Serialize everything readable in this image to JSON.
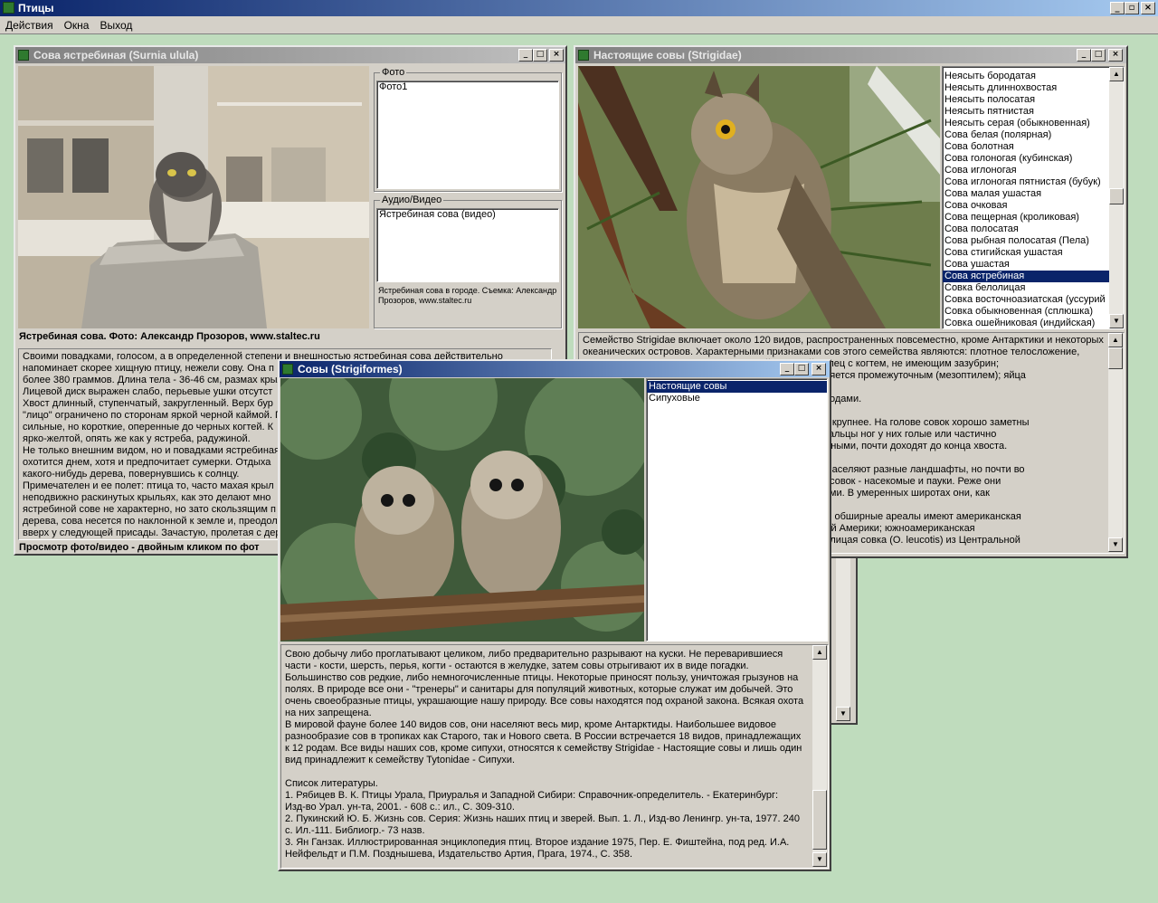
{
  "app": {
    "title": "Птицы"
  },
  "menu": [
    "Действия",
    "Окна",
    "Выход"
  ],
  "win1": {
    "title": "Сова ястребиная (Surnia ulula)",
    "photo_group": "Фото",
    "photo_items": [
      "Фото1"
    ],
    "av_group": "Аудио/Видео",
    "av_items": [
      "Ястребиная сова (видео)"
    ],
    "av_caption": "Ястребиная сова в городе. Съемка: Александр Прозоров, www.staltec.ru",
    "photo_caption": "Ястребиная сова. Фото: Александр Прозоров, www.staltec.ru",
    "description": "Своими повадками, голосом, а в определенной степени и внешностью ястребиная сова действительно\nнапоминает скорее хищную птицу, нежели сову. Она п\nболее 380 граммов. Длина тела - 36-46 см, размах крыл\nЛицевой диск выражен слабо, перьевые ушки отсутст\nХвост длинный, ступенчатый, закругленный. Верх бур\n\"лицо\" ограничено по сторонам яркой черной каймой. П\nсильные, но короткие, оперенные до черных когтей. К\nярко-желтой, опять же как у ястреба, радужиной.\nНе только внешним видом, но и повадками ястребиная\nохотится днем, хотя и предпочитает сумерки. Отдыха\nкакого-нибудь дерева, повернувшись к солнцу.\nПримечателен и ее полет: птица то, часто махая крыл\nнеподвижно раскинутых крыльях, как это делают мно\nястребиной сове не характерно, но зато скользящим п\nдерева, сова несется по наклонной к земле и, преодол\nвверх у следующей присады. Зачастую, пролетая с дер",
    "hint": "Просмотр фото/видео - двойным кликом по фот"
  },
  "win2": {
    "title": "Настоящие совы (Strigidae)",
    "list": [
      "Неясыть бородатая",
      "Неясыть длиннохвостая",
      "Неясыть полосатая",
      "Неясыть пятнистая",
      "Неясыть серая (обыкновенная)",
      "Сова белая (полярная)",
      "Сова болотная",
      "Сова голоногая (кубинская)",
      "Сова иглоногая",
      "Сова иглоногая пятнистая (бубук)",
      "Сова малая ушастая",
      "Сова очковая",
      "Сова пещерная (кроликовая)",
      "Сова полосатая",
      "Сова рыбная полосатая (Пела)",
      "Сова стигийская ушастая",
      "Сова ушастая",
      "Сова ястребиная",
      "Совка белолицая",
      "Совка восточноазиатская (уссурий",
      "Совка обыкновенная (сплюшка)",
      "Совка ошейниковая (индийская)"
    ],
    "selected": "Сова ястребиная",
    "description": "Семейство Strigidae включает около 120 видов, распространенных повсеместно, кроме Антарктики и некоторых\nокеанических островов. Характерными признаками сов этого семейства являются: плотное телосложение,\n                                                              ний, средний палец с когтем, не имеющим зазубрин;\n                                                              о развития сменяется промежуточным (мезоптилем); яйца\n\n                                                              одиннадцатью родами.\n\n                                                              оворца или чуть крупнее. На голове совок хорошо заметны\n                                                              ных филинов. Пальцы ног у них голые или частично\n                                                              а будучи сложенными, почти доходят до конца хвоста.\n\n                                                              руппа сов. Они населяют разные ландшафты, но почти во\n                                                              Основная пища совок - насекомые и пауки. Реже они\n                                                              ими позвоночными. В умеренных широтах они, как\n\n                                                              Из них наиболее обширные ареалы имеют американская\n                                                              й части Северной Америки; южноамериканская\n                                                              й Америки; белолицая совка (O. leucotis) из Центральной"
  },
  "win3": {
    "title": "Совы (Strigiformes)",
    "list": [
      "Настоящие совы",
      "Сипуховые"
    ],
    "selected": "Настоящие совы",
    "description": "Свою добычу либо проглатывают целиком, либо предварительно разрывают на куски. Не переварившиеся\nчасти - кости, шерсть, перья, когти - остаются в желудке, затем совы отрыгивают их в виде погадки.\nБольшинство сов редкие, либо немногочисленные птицы. Некоторые приносят пользу, уничтожая грызунов на\nполях. В природе все они - \"тренеры\" и санитары для популяций животных, которые служат им добычей. Это\nочень своеобразные птицы, украшающие нашу природу. Все совы находятся под охраной закона. Всякая охота\nна них запрещена.\nВ мировой фауне более 140 видов сов, они населяют весь мир, кроме Антарктиды. Наибольшее видовое\nразнообразие сов в тропиках как Старого, так и Нового света. В России встречается 18 видов, принадлежащих\nк 12 родам. Все виды наших сов, кроме сипухи, относятся к семейству Strigidae - Настоящие совы и лишь один\nвид принадлежит к семейству Tytonidae - Сипухи.\n\nСписок литературы.\n1. Рябицев В. К. Птицы Урала, Приуралья и Западной Сибири: Справочник-определитель. - Екатеринбург:\nИзд-во Урал. ун-та, 2001. - 608 с.: ил., С. 309-310.\n2. Пукинский Ю. Б. Жизнь сов. Серия: Жизнь наших птиц и зверей. Вып. 1. Л., Изд-во Ленингр. ун-та, 1977. 240\nс. Ил.-111. Библиогр.- 73 назв.\n3. Ян Ганзак. Иллюстрированная энциклопедия птиц. Второе издание 1975, Пер. Е. Фиштейна, под ред. И.А.\nНейфельдт и П.М. Позднышева, Издательство Артия, Прага, 1974., С. 358."
  },
  "icons": {
    "minimize": "minimize-icon",
    "maximize": "maximize-icon",
    "close": "close-icon",
    "scroll_up": "arrow-up-icon",
    "scroll_down": "arrow-down-icon"
  }
}
